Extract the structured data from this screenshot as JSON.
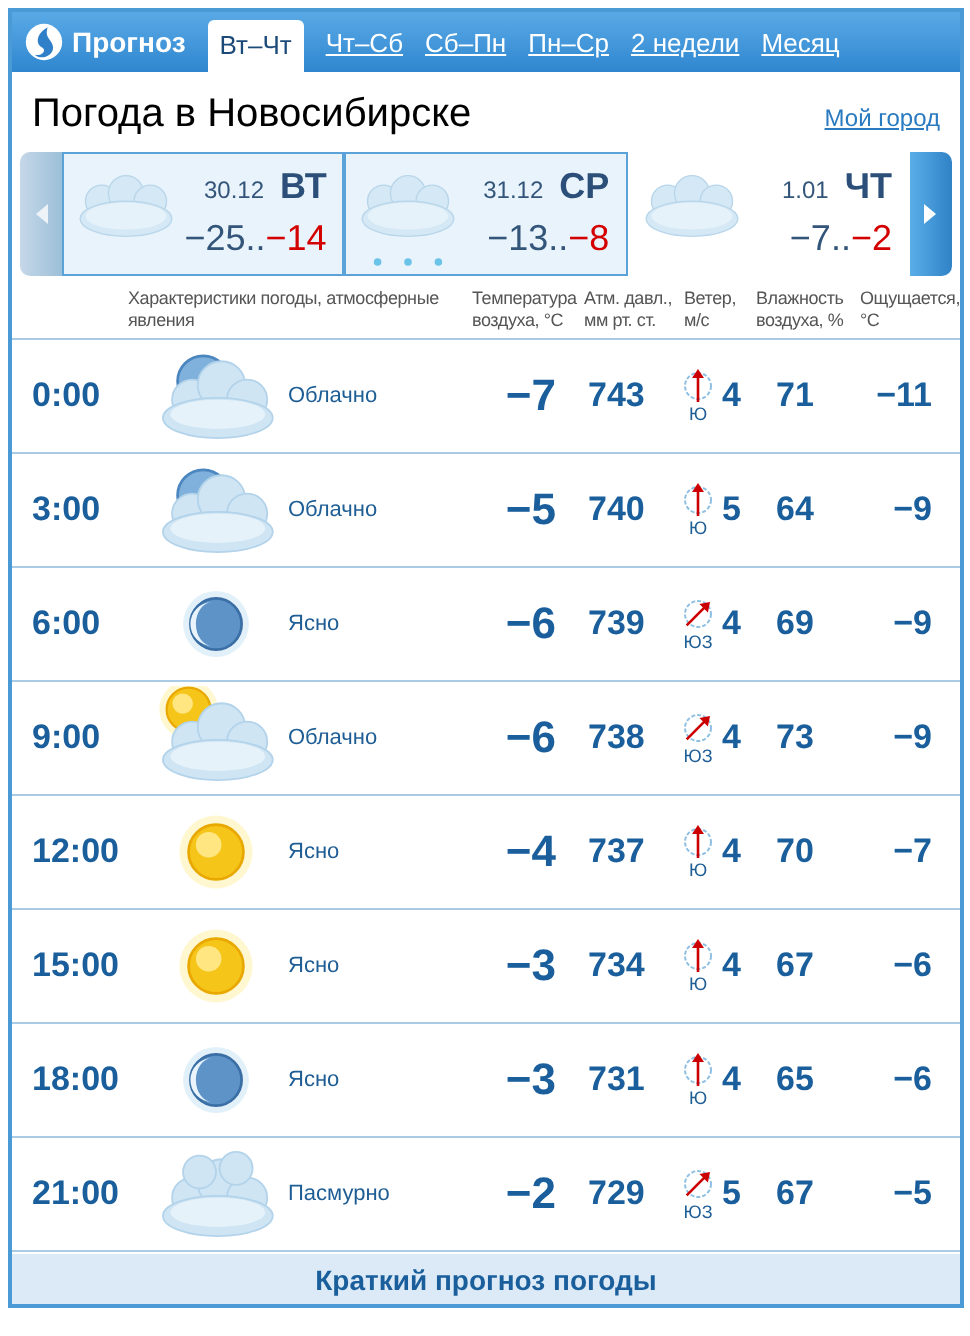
{
  "header": {
    "brand": "Прогноз",
    "tabs": [
      {
        "label": "Вт–Чт",
        "selected": true
      },
      {
        "label": "Чт–Сб",
        "selected": false
      },
      {
        "label": "Сб–Пн",
        "selected": false
      },
      {
        "label": "Пн–Ср",
        "selected": false
      },
      {
        "label": "2 недели",
        "selected": false
      },
      {
        "label": "Месяц",
        "selected": false
      }
    ]
  },
  "title": "Погода в Новосибирске",
  "my_city_link": "Мой город",
  "days": [
    {
      "date": "30.12",
      "weekday": "ВТ",
      "low": "−25..",
      "high": "−14",
      "selected": true,
      "snow": false
    },
    {
      "date": "31.12",
      "weekday": "СР",
      "low": "−13..",
      "high": "−8",
      "selected": true,
      "snow": true
    },
    {
      "date": "1.01",
      "weekday": "ЧТ",
      "low": "−7..",
      "high": "−2",
      "selected": false,
      "snow": false
    }
  ],
  "columns": {
    "conditions": "Характеристики погоды, атмосферные явления",
    "temperature": "Температура воздуха, °С",
    "pressure": "Атм. давл., мм рт. ст.",
    "wind": "Ветер, м/с",
    "humidity": "Влажность воздуха, %",
    "feels": "Ощущается, °С"
  },
  "rows": [
    {
      "time": "0:00",
      "kind": "cloudmoon",
      "condition": "Облачно",
      "temp": "−7",
      "pressure": "743",
      "wind": {
        "kind": "south",
        "direction": "Ю",
        "speed": "4"
      },
      "humidity": "71",
      "feels": "−11"
    },
    {
      "time": "3:00",
      "kind": "cloudmoon",
      "condition": "Облачно",
      "temp": "−5",
      "pressure": "740",
      "wind": {
        "kind": "south",
        "direction": "Ю",
        "speed": "5"
      },
      "humidity": "64",
      "feels": "−9"
    },
    {
      "time": "6:00",
      "kind": "moon",
      "condition": "Ясно",
      "temp": "−6",
      "pressure": "739",
      "wind": {
        "kind": "southwest",
        "direction": "ЮЗ",
        "speed": "4"
      },
      "humidity": "69",
      "feels": "−9"
    },
    {
      "time": "9:00",
      "kind": "cloudsun",
      "condition": "Облачно",
      "temp": "−6",
      "pressure": "738",
      "wind": {
        "kind": "southwest",
        "direction": "ЮЗ",
        "speed": "4"
      },
      "humidity": "73",
      "feels": "−9"
    },
    {
      "time": "12:00",
      "kind": "sun",
      "condition": "Ясно",
      "temp": "−4",
      "pressure": "737",
      "wind": {
        "kind": "south",
        "direction": "Ю",
        "speed": "4"
      },
      "humidity": "70",
      "feels": "−7"
    },
    {
      "time": "15:00",
      "kind": "sun",
      "condition": "Ясно",
      "temp": "−3",
      "pressure": "734",
      "wind": {
        "kind": "south",
        "direction": "Ю",
        "speed": "4"
      },
      "humidity": "67",
      "feels": "−6"
    },
    {
      "time": "18:00",
      "kind": "moon",
      "condition": "Ясно",
      "temp": "−3",
      "pressure": "731",
      "wind": {
        "kind": "south",
        "direction": "Ю",
        "speed": "4"
      },
      "humidity": "65",
      "feels": "−6"
    },
    {
      "time": "21:00",
      "kind": "clouds",
      "condition": "Пасмурно",
      "temp": "−2",
      "pressure": "729",
      "wind": {
        "kind": "southwest",
        "direction": "ЮЗ",
        "speed": "5"
      },
      "humidity": "67",
      "feels": "−5"
    }
  ],
  "footer_link": "Краткий прогноз погоды"
}
